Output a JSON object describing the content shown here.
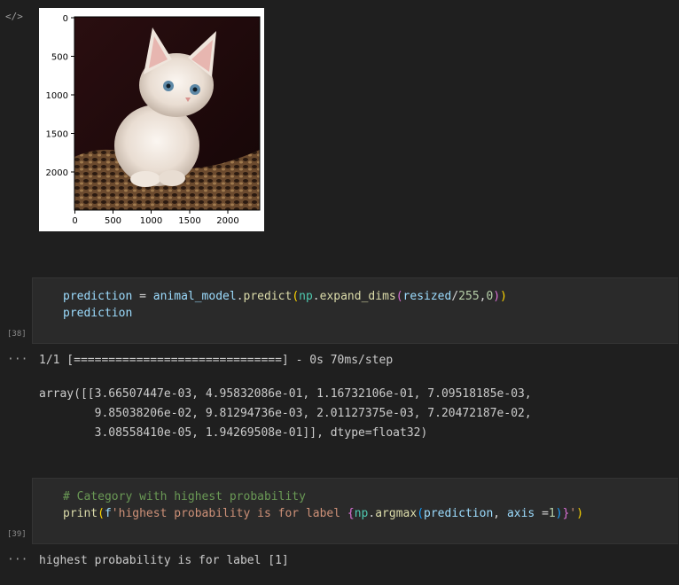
{
  "gutter": {
    "code_icon": "</>",
    "ellipsis": "···",
    "cell1_count": "[38]",
    "cell2_count": "[39]"
  },
  "plot": {
    "image_description_icon": "kitten-image",
    "y_ticks": [
      "0",
      "500",
      "1000",
      "1500",
      "2000"
    ],
    "x_ticks": [
      "0",
      "500",
      "1000",
      "1500",
      "2000"
    ]
  },
  "cell1": {
    "line1": {
      "var": "prediction",
      "eq": " = ",
      "obj": "animal_model",
      "dot": ".",
      "method": "predict",
      "open": "(",
      "mod": "np",
      "dot2": ".",
      "fn": "expand_dims",
      "open2": "(",
      "arg": "resized",
      "div": "/",
      "num1": "255",
      "comma": ",",
      "num2": "0",
      "close2": ")",
      "close": ")"
    },
    "line2": "prediction"
  },
  "output1": {
    "progress": "1/1 [==============================] - 0s 70ms/step",
    "array_line1": "array([[3.66507447e-03, 4.95832086e-01, 1.16732106e-01, 7.09518185e-03,",
    "array_line2": "        9.85038206e-02, 9.81294736e-03, 2.01127375e-03, 7.20472187e-02,",
    "array_line3": "        3.08558410e-05, 1.94269508e-01]], dtype=float32)"
  },
  "cell2": {
    "comment": "# Category with highest probability",
    "print_fn": "print",
    "p_open": "(",
    "f_prefix": "f",
    "str_start": "'highest probability is for label ",
    "brace_open": "{",
    "mod": "np",
    "dot": ".",
    "fn": "argmax",
    "a_open": "(",
    "arg1": "prediction",
    "comma": ", ",
    "kw": "axis",
    "eq": " =",
    "num": "1",
    "a_close": ")",
    "brace_close": "}",
    "str_end": "'",
    "p_close": ")"
  },
  "output2": {
    "text": "highest probability is for label [1]"
  }
}
